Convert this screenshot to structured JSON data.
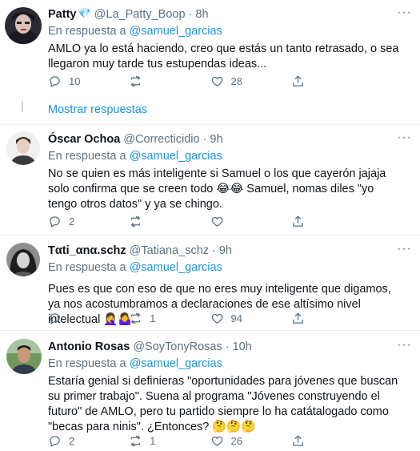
{
  "tweets": [
    {
      "name": "Patty",
      "verified_icon": "💎",
      "handle": "@La_Patty_Boop",
      "dot": "·",
      "time": "8h",
      "reply_prefix": "En respuesta a",
      "reply_to": "@samuel_garcias",
      "text": "AMLO ya lo está haciendo, creo que estás un tanto retrasado, o sea llegaron muy tarde tus estupendas ideas...",
      "replies": "10",
      "retweets": "",
      "likes": "28"
    },
    {
      "name": "Óscar Ochoa",
      "handle": "@Correcticidio",
      "dot": "·",
      "time": "9h",
      "reply_prefix": "En respuesta a",
      "reply_to": "@samuel_garcias",
      "text": "No se quien es más inteligente si Samuel o los que cayerón jajaja solo confirma que se creen todo 😂😂 Samuel, nomas diles \"yo tengo otros datos\" y ya se chingo.",
      "replies": "2",
      "retweets": "",
      "likes": ""
    },
    {
      "name": "Tαti_αnα.schz",
      "handle": "@Tatiana_schz",
      "dot": "·",
      "time": "9h",
      "reply_prefix": "En respuesta a",
      "reply_to": "@samuel_garcias",
      "text": "Pues es que con eso de que no eres muy inteligente que digamos, ya nos acostumbramos a declaraciones de ese altísimo nivel intelectual 🤦‍♀️🤷‍♀️",
      "replies": "",
      "retweets": "1",
      "likes": "94"
    },
    {
      "name": "Antonio Rosas",
      "handle": "@SoyTonyRosas",
      "dot": "·",
      "time": "10h",
      "reply_prefix": "En respuesta a",
      "reply_to": "@samuel_garcias",
      "text": "Estaría genial si definieras \"oportunidades para jóvenes que buscan su primer trabajo\". Suena al programa \"Jóvenes construyendo el futuro\" de AMLO, pero tu partido siempre lo ha catátalogado como \"becas para ninis\". ¿Entonces? 🤔🤔🤔",
      "replies": "2",
      "retweets": "1",
      "likes": "26"
    }
  ],
  "show_replies": "Mostrar respuestas",
  "more_icon": "···",
  "colors": {
    "accent": "#1b95e0",
    "muted": "#5b7083",
    "divider": "#ebeef0"
  }
}
